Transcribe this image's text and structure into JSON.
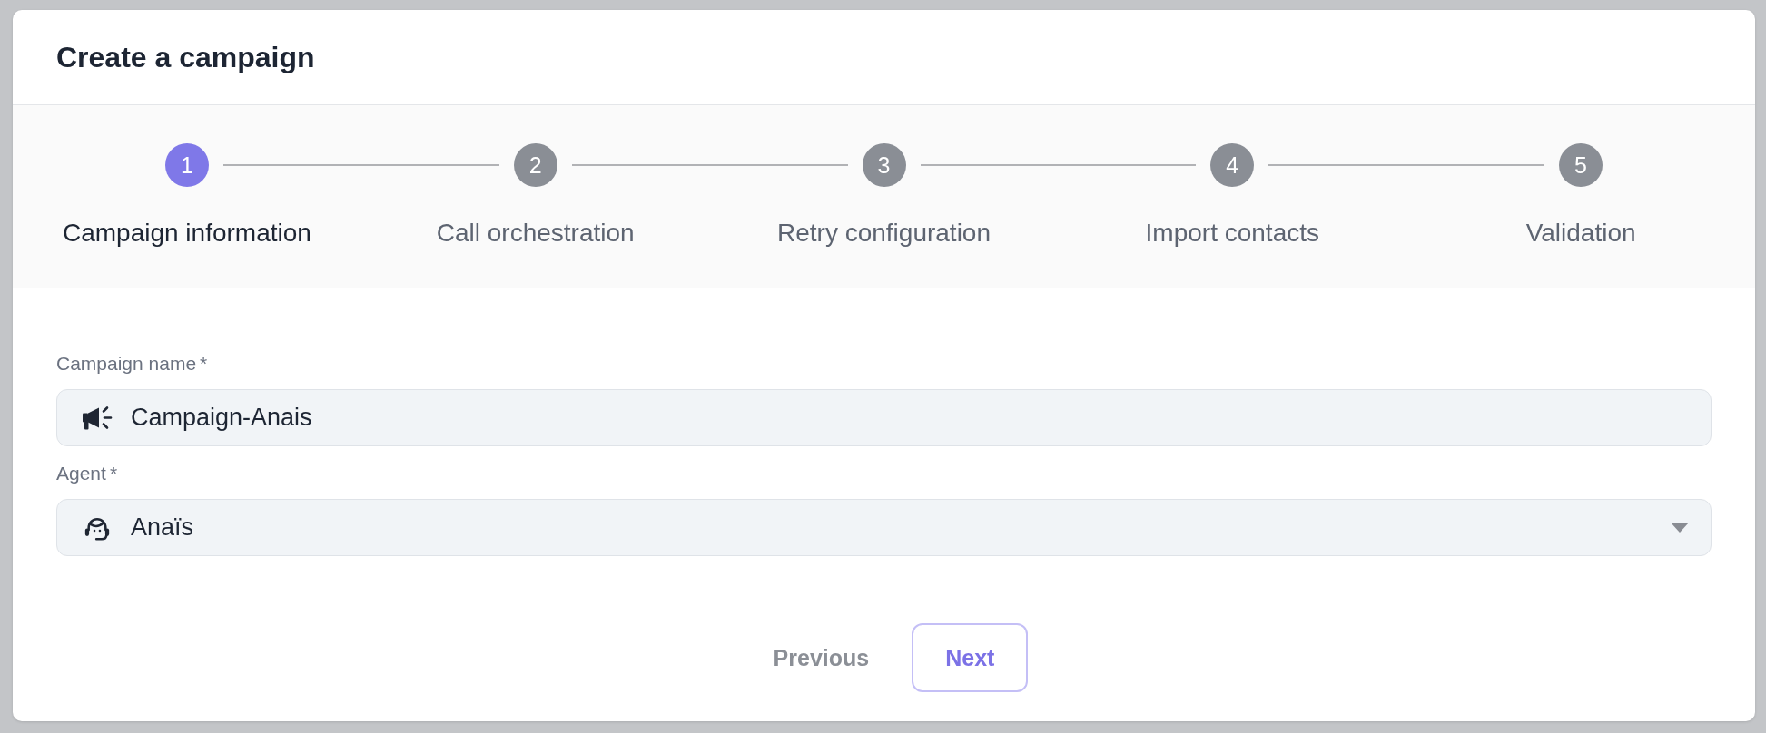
{
  "dialog": {
    "title": "Create a campaign"
  },
  "steps": [
    {
      "number": "1",
      "label": "Campaign information",
      "selected": true
    },
    {
      "number": "2",
      "label": "Call orchestration",
      "selected": false
    },
    {
      "number": "3",
      "label": "Retry configuration",
      "selected": false
    },
    {
      "number": "4",
      "label": "Import contacts",
      "selected": false
    },
    {
      "number": "5",
      "label": "Validation",
      "selected": false
    }
  ],
  "fields": [
    {
      "kind": "text",
      "label": "Campaign name",
      "required_mark": "*",
      "value": "Campaign-Anais"
    },
    {
      "kind": "select",
      "label": "Agent",
      "required_mark": "*",
      "value": "Anaïs"
    }
  ],
  "buttons": [
    {
      "kind": "text",
      "label": "Previous"
    },
    {
      "kind": "outlined",
      "label": "Next"
    }
  ]
}
